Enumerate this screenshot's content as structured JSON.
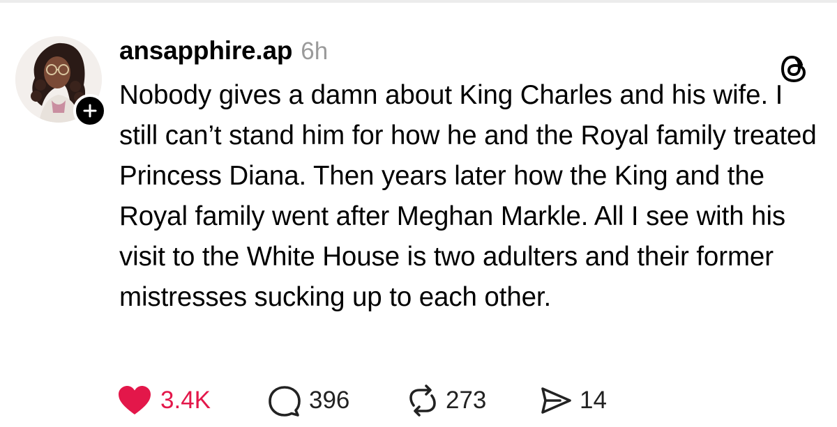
{
  "post": {
    "username": "ansapphire.ap",
    "timestamp": "6h",
    "text": "Nobody gives a damn about King Charles and his wife. I still can’t stand him for how he and the Royal family treated Princess Diana. Then years later how the King and the Royal family went after Meghan Markle. All I see with his visit to the White House is two adulters and their former mistresses sucking up to each other.",
    "avatar_icon": "profile-photo",
    "follow_badge_icon": "plus-icon",
    "app_logo_icon": "threads-logo-icon"
  },
  "actions": {
    "likes": {
      "icon": "heart-icon",
      "count": "3.4K",
      "liked": true
    },
    "replies": {
      "icon": "speech-bubble-icon",
      "count": "396"
    },
    "reposts": {
      "icon": "repost-icon",
      "count": "273"
    },
    "shares": {
      "icon": "send-icon",
      "count": "14"
    }
  },
  "colors": {
    "like_active": "#e3174a",
    "text_primary": "#000000",
    "text_secondary": "#9a9a9a",
    "background": "#ffffff"
  }
}
